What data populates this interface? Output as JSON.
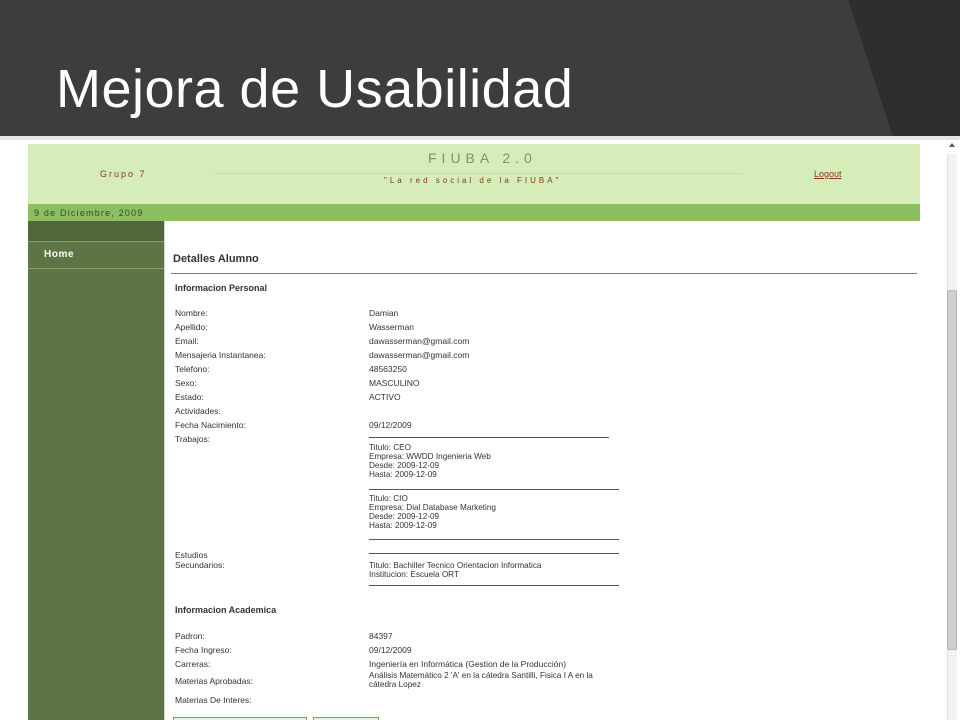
{
  "slide": {
    "title": "Mejora de Usabilidad"
  },
  "site": {
    "group": "Grupo 7",
    "brand": "FIUBA 2.0",
    "tagline": "\"La red social de la FIUBA\"",
    "logout": "Logout",
    "date": "9 de Diciembre, 2009"
  },
  "sidebar": {
    "items": [
      {
        "label": "Home"
      }
    ]
  },
  "details": {
    "title": "Detalles Alumno",
    "personal": {
      "title": "Informacion Personal",
      "rows": [
        {
          "label": "Nombre:",
          "value": "Damian"
        },
        {
          "label": "Apellido:",
          "value": "Wasserman"
        },
        {
          "label": "Email:",
          "value": "dawasserman@gmail.com"
        },
        {
          "label": "Mensajeria Instantanea:",
          "value": "dawasserman@gmail.com"
        },
        {
          "label": "Telefono:",
          "value": "48563250"
        },
        {
          "label": "Sexo:",
          "value": "MASCULINO"
        },
        {
          "label": "Estado:",
          "value": "ACTIVO"
        },
        {
          "label": "Actividades:",
          "value": ""
        },
        {
          "label": "Fecha Nacimiento:",
          "value": "09/12/2009"
        }
      ],
      "trabajos_label": "Trabajos:",
      "trabajos": [
        {
          "titulo": "Titulo: CEO",
          "empresa": "Empresa: WWDD Ingenieria Web",
          "desde": "Desde: 2009-12-09",
          "hasta": "Hasta: 2009-12-09"
        },
        {
          "titulo": "Titulo: CIO",
          "empresa": "Empresa: Dial Database Marketing",
          "desde": "Desde: 2009-12-09",
          "hasta": "Hasta: 2009-12-09"
        }
      ],
      "estudios_label_1": "Estudios",
      "estudios_label_2": "Secundarios:",
      "estudios": {
        "titulo": "Titulo: Bachiller Tecnico Orientacion Informatica",
        "institucion": "Institucion: Escuela ORT"
      }
    },
    "academica": {
      "title": "Informacion Academica",
      "rows": [
        {
          "label": "Padron:",
          "value": "84397"
        },
        {
          "label": "Fecha Ingreso:",
          "value": "09/12/2009"
        },
        {
          "label": "Carreras:",
          "value": "Ingeniería en Informática (Gestion de la Producción)"
        }
      ],
      "materias_aprobadas_label": "Materias Aprobadas:",
      "materias_aprobadas_line1": "Análisis Matemático 2 'A' en la cátedra Santilli, Fisica I A en la",
      "materias_aprobadas_line2": "cátedra Lopez",
      "materias_interes_label": "Materias De Interes:"
    }
  }
}
